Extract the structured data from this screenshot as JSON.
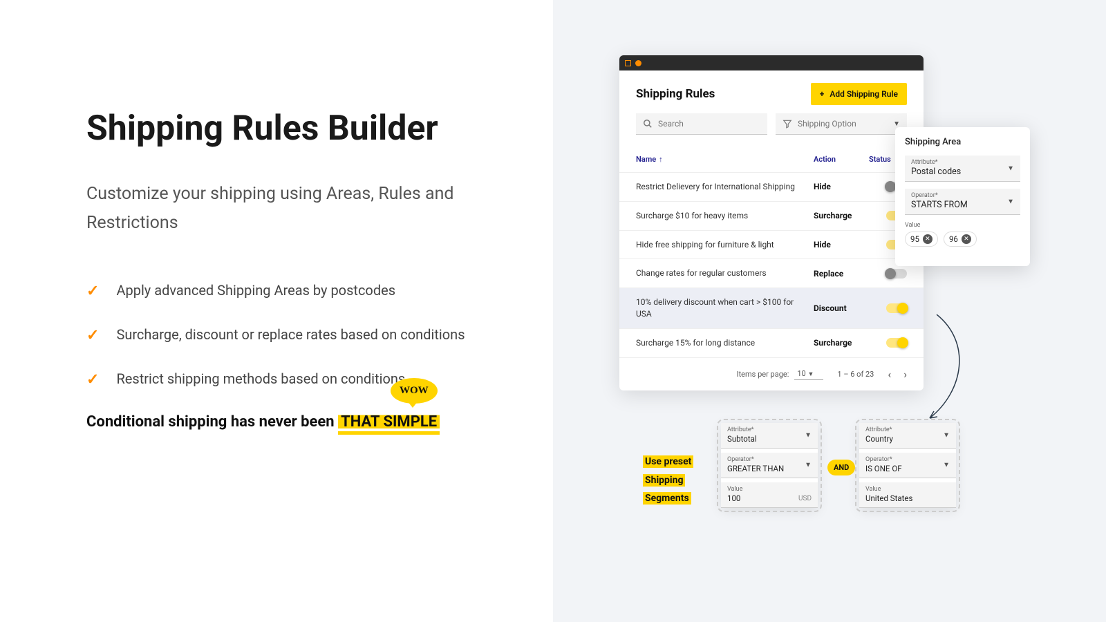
{
  "left": {
    "title": "Shipping Rules Builder",
    "subtitle": "Customize your shipping using Areas, Rules and Restrictions",
    "features": [
      "Apply advanced Shipping Areas by postcodes",
      "Surcharge, discount or replace rates based on conditions",
      "Restrict shipping methods based on conditions"
    ],
    "tagline_pre": "Conditional shipping has never been ",
    "tagline_hl": "THAT SIMPLE",
    "wow": "WOW"
  },
  "app": {
    "title": "Shipping Rules",
    "add_btn": "Add Shipping Rule",
    "search_placeholder": "Search",
    "filter_label": "Shipping Option",
    "cols": {
      "name": "Name",
      "action": "Action",
      "status": "Status"
    },
    "rows": [
      {
        "name": "Restrict Delievery for International Shipping",
        "action": "Hide",
        "on": false,
        "sel": false
      },
      {
        "name": "Surcharge $10 for heavy items",
        "action": "Surcharge",
        "on": true,
        "sel": false
      },
      {
        "name": "Hide free shipping for furniture & light",
        "action": "Hide",
        "on": true,
        "sel": false
      },
      {
        "name": "Change rates for regular customers",
        "action": "Replace",
        "on": false,
        "sel": false
      },
      {
        "name": "10% delivery discount when cart > $100 for USA",
        "action": "Discount",
        "on": true,
        "sel": true
      },
      {
        "name": "Surcharge 15% for long distance",
        "action": "Surcharge",
        "on": true,
        "sel": false
      }
    ],
    "pager": {
      "ipp_label": "Items per page:",
      "ipp_value": "10",
      "range": "1 – 6 of 23"
    }
  },
  "area": {
    "title": "Shipping Area",
    "attr_label": "Attribute*",
    "attr_value": "Postal codes",
    "op_label": "Operator*",
    "op_value": "STARTS FROM",
    "val_label": "Value",
    "chips": [
      "95",
      "96"
    ]
  },
  "seg": {
    "preset_lines": [
      "Use preset",
      "Shipping",
      "Segments"
    ],
    "and": "AND",
    "card1": {
      "attr_label": "Attribute*",
      "attr": "Subtotal",
      "op_label": "Operator*",
      "op": "GREATER THAN",
      "val_label": "Value",
      "val": "100",
      "unit": "USD"
    },
    "card2": {
      "attr_label": "Attribute*",
      "attr": "Country",
      "op_label": "Operator*",
      "op": "IS ONE OF",
      "val_label": "Value",
      "val": "United States"
    }
  }
}
